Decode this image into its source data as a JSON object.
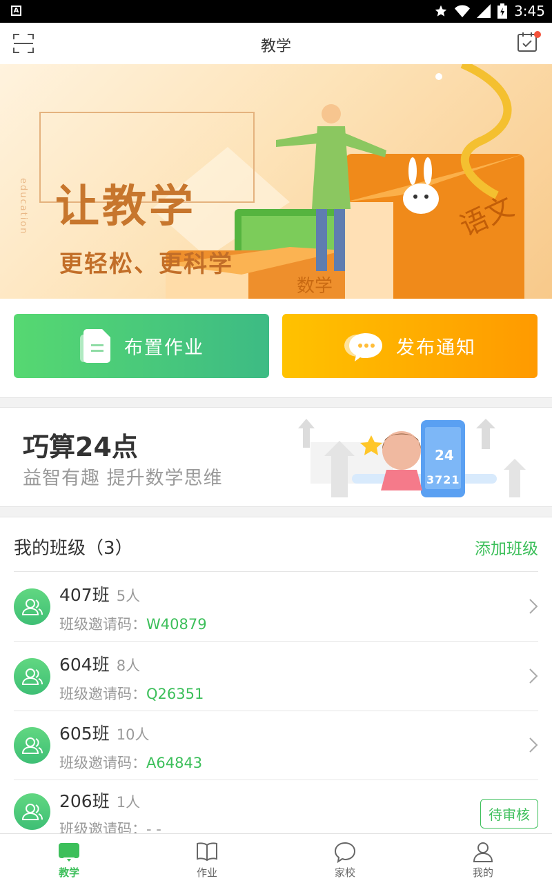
{
  "status_bar": {
    "time": "3:45",
    "app_icon": "A"
  },
  "app_bar": {
    "title": "教学",
    "left_icon": "scan-icon",
    "right_icon": "calendar-check-icon",
    "notify_color": "#f4523b"
  },
  "banner": {
    "side_text": "education",
    "headline": "让教学",
    "subline": "更轻松、更科学",
    "book_label": "语文",
    "book_label2": "数学"
  },
  "actions": {
    "assign_homework": "布置作业",
    "publish_notice": "发布通知"
  },
  "promo": {
    "title": "巧算24点",
    "subtitle": "益智有趣  提升数学思维",
    "card_num": "24",
    "card_digits": "3721"
  },
  "classes": {
    "title": "我的班级（3）",
    "add_label": "添加班级",
    "code_label": "班级邀请码：",
    "items": [
      {
        "name": "407班",
        "count": "5人",
        "code": "W40879",
        "status": ""
      },
      {
        "name": "604班",
        "count": "8人",
        "code": "Q26351",
        "status": ""
      },
      {
        "name": "605班",
        "count": "10人",
        "code": "A64843",
        "status": ""
      },
      {
        "name": "206班",
        "count": "1人",
        "code": "- -",
        "status": "待审核"
      }
    ]
  },
  "tabs": [
    {
      "label": "教学",
      "icon": "chat-board-icon",
      "active": true
    },
    {
      "label": "作业",
      "icon": "book-icon",
      "active": false
    },
    {
      "label": "家校",
      "icon": "speech-bubble-icon",
      "active": false
    },
    {
      "label": "我的",
      "icon": "person-icon",
      "active": false
    }
  ],
  "colors": {
    "brand_green": "#3cbf5a",
    "accent_orange": "#ff9a00"
  }
}
